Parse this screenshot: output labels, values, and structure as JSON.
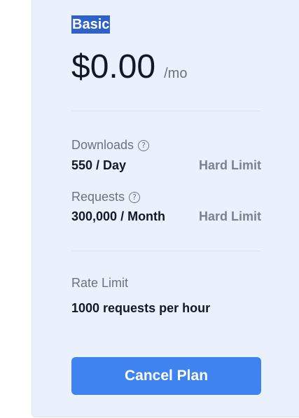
{
  "plan": {
    "name": "Basic",
    "price": "$0.00",
    "period": "/mo"
  },
  "limits": [
    {
      "label": "Downloads",
      "icon": "help-circle-icon",
      "value": "550 / Day",
      "type": "Hard Limit"
    },
    {
      "label": "Requests",
      "icon": "help-circle-icon",
      "value": "300,000 / Month",
      "type": "Hard Limit"
    }
  ],
  "rate_limit": {
    "label": "Rate Limit",
    "value": "1000 requests per hour"
  },
  "actions": {
    "cancel_label": "Cancel Plan"
  },
  "colors": {
    "card_background": "#eaf1fd",
    "button": "#3f83f0",
    "highlight": "#2f62c9"
  }
}
